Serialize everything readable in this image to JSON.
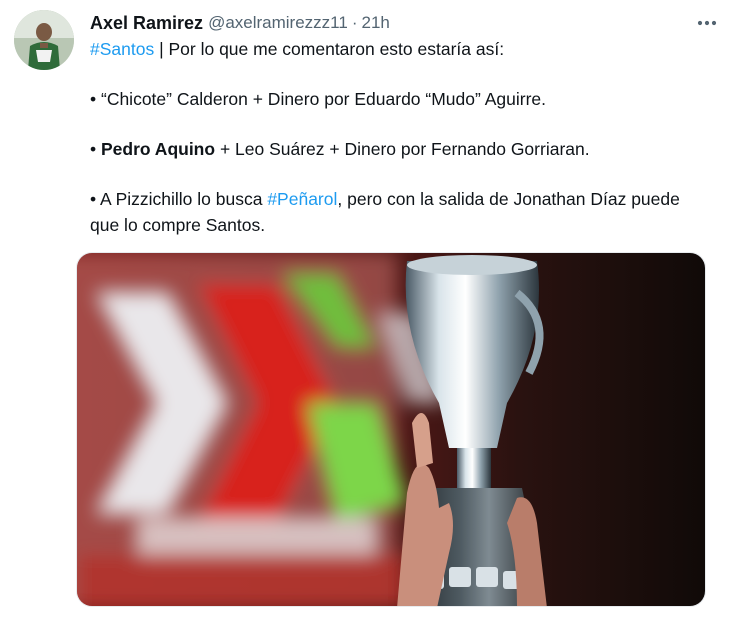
{
  "tweet": {
    "author_name": "Axel Ramirez",
    "handle": "@axelramirezzz11",
    "separator": "·",
    "time": "21h",
    "line1_hashtag": "#Santos",
    "line1_rest": " | Por lo que me comentaron esto estaría así:",
    "line2": "• “Chicote” Calderon + Dinero por Eduardo “Mudo” Aguirre.",
    "line3_bullet": "• ",
    "line3_bold": "Pedro Aquino",
    "line3_rest": " + Leo Suárez + Dinero por Fernando Gorriaran.",
    "line4_pre": "• A Pizzichillo lo busca ",
    "line4_hashtag": "#Peñarol",
    "line4_post": ", pero con la salida de Jonathan Díaz puede",
    "line5": "que lo compre Santos."
  },
  "icons": {
    "more": "more-horizontal-icon"
  },
  "colors": {
    "link": "#1d9bf0",
    "text": "#0f1419",
    "secondary": "#536471"
  }
}
